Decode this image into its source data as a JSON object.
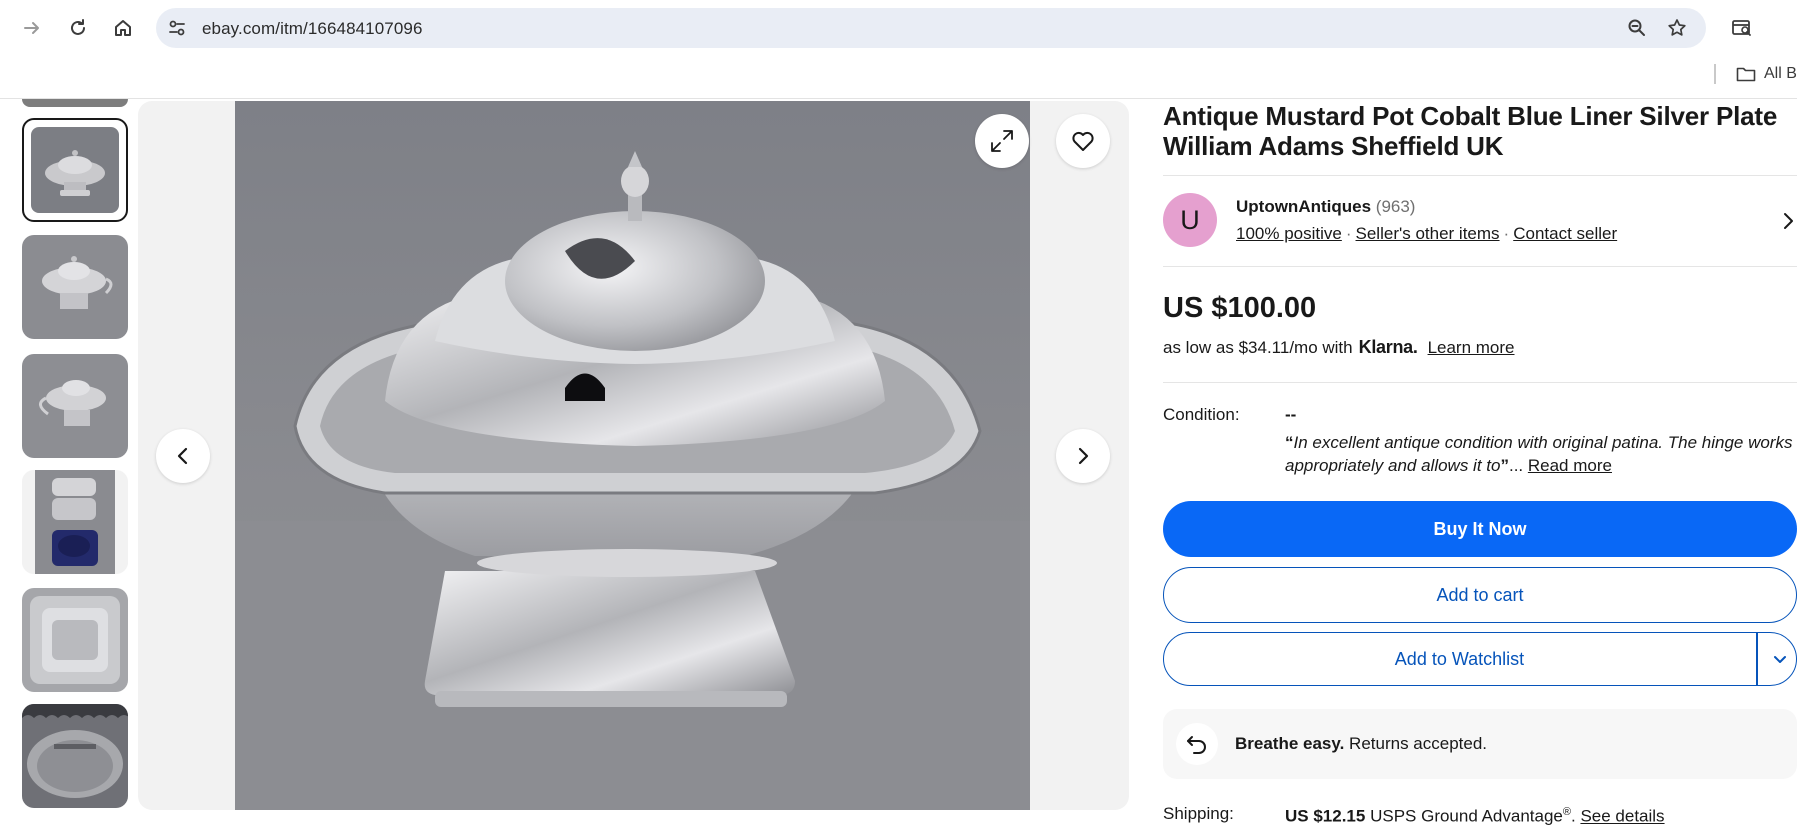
{
  "browser": {
    "url": "ebay.com/itm/166484107096",
    "bookmarks_label": "All B"
  },
  "gallery": {
    "thumbnails": [
      {
        "name": "mustard-pot-front"
      },
      {
        "name": "mustard-pot-angle"
      },
      {
        "name": "mustard-pot-side"
      },
      {
        "name": "mustard-pot-open-liner"
      },
      {
        "name": "mustard-pot-base-marks"
      },
      {
        "name": "mustard-pot-hallmarks"
      }
    ],
    "active_index": 0
  },
  "listing": {
    "title": "Antique Mustard Pot Cobalt Blue Liner Silver Plate William Adams Sheffield UK",
    "seller": {
      "avatar_letter": "U",
      "name": "UptownAntiques",
      "feedback_count": "(963)",
      "positive": "100% positive",
      "other_items": "Seller's other items",
      "contact": "Contact seller"
    },
    "price": "US $100.00",
    "financing": {
      "text": "as low as $34.11/mo with",
      "provider": "Klarna.",
      "learn_more": "Learn more"
    },
    "condition": {
      "label": "Condition:",
      "value": "--",
      "quote": "In excellent antique condition with original patina. The hinge works appropriately and allows it to",
      "ellipsis": "...",
      "read_more": "Read more"
    },
    "buttons": {
      "buy_now": "Buy It Now",
      "add_to_cart": "Add to cart",
      "add_to_watchlist": "Add to Watchlist"
    },
    "returns": {
      "bold": "Breathe easy.",
      "text": "Returns accepted."
    },
    "shipping": {
      "label": "Shipping:",
      "cost": "US $12.15",
      "service": "USPS Ground Advantage",
      "mark": "®",
      "see_details": "See details"
    }
  },
  "colors": {
    "primary_button": "#0968f6",
    "outline_button": "#0654ba",
    "avatar_bg": "#e5a0cf"
  }
}
